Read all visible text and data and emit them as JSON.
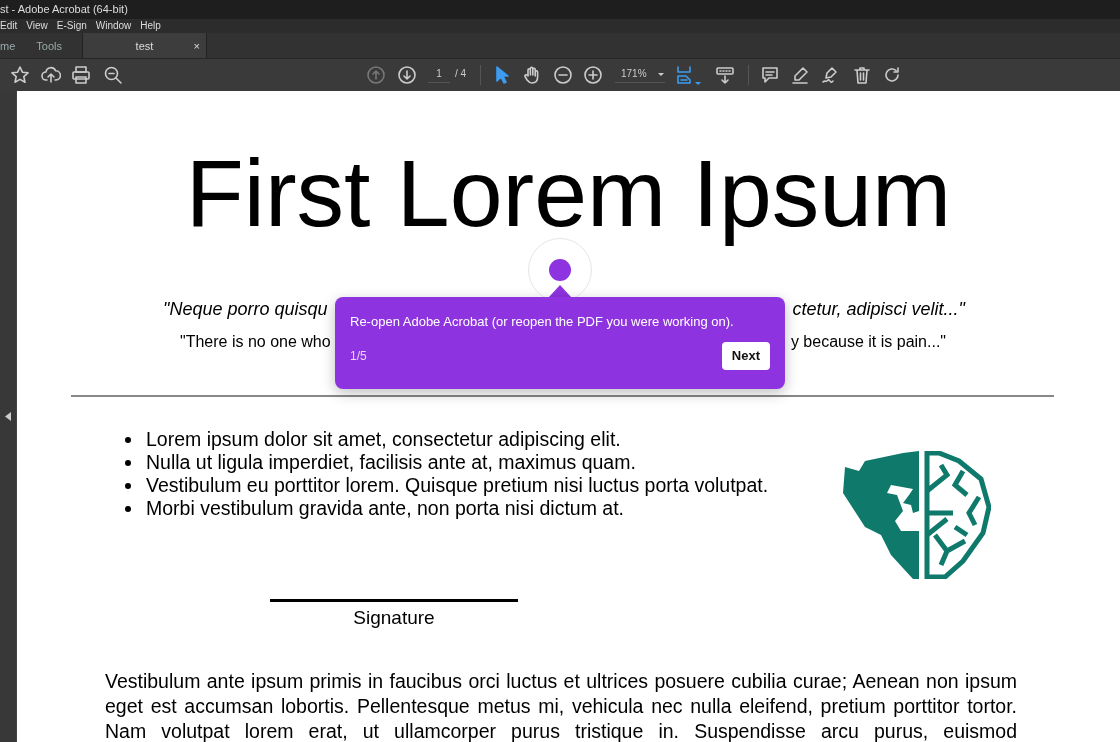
{
  "window": {
    "title": "st - Adobe Acrobat (64-bit)"
  },
  "menu": [
    "Edit",
    "View",
    "E-Sign",
    "Window",
    "Help"
  ],
  "tabs": [
    {
      "label": "me",
      "selected": false
    },
    {
      "label": "Tools",
      "selected": false
    },
    {
      "label": "test",
      "selected": true,
      "close": "×"
    }
  ],
  "toolbar": {
    "previous_page_disabled": true,
    "page": "1",
    "page_count": "/ 4",
    "tools": [
      {
        "selected": true
      },
      {
        "selected": false
      }
    ],
    "zoom": "171%"
  },
  "document": {
    "heading": "First Lorem Ipsum",
    "quotes": [
      {
        "left": "\"Neque porro quisqu",
        "right": "ctetur, adipisci velit...\""
      },
      {
        "left": "\"There is no one who",
        "right": "y because it is pain...\""
      }
    ],
    "bullets": [
      "Lorem ipsum dolor sit amet, consectetur adipiscing elit.",
      "Nulla ut ligula imperdiet, facilisis ante at, maximus quam.",
      "Vestibulum eu porttitor lorem. Quisque pretium nisi luctus porta volutpat.",
      "Morbi vestibulum gravida ante, non porta nisi dictum at."
    ],
    "signature_label": "Signature",
    "paragraph": "Vestibulum ante ipsum primis in faucibus orci luctus et ultrices posuere cubilia curae; Aenean non ipsum eget est accumsan lobortis. Pellentesque metus mi, vehicula nec nulla eleifend, pretium porttitor tortor. Nam volutpat lorem erat, ut ullamcorper purus tristique in. Suspendisse arcu purus, euismod"
  },
  "tour": {
    "text": "Re-open Adobe Acrobat (or reopen the PDF you were working on).",
    "step": "1/5",
    "button": "Next"
  }
}
